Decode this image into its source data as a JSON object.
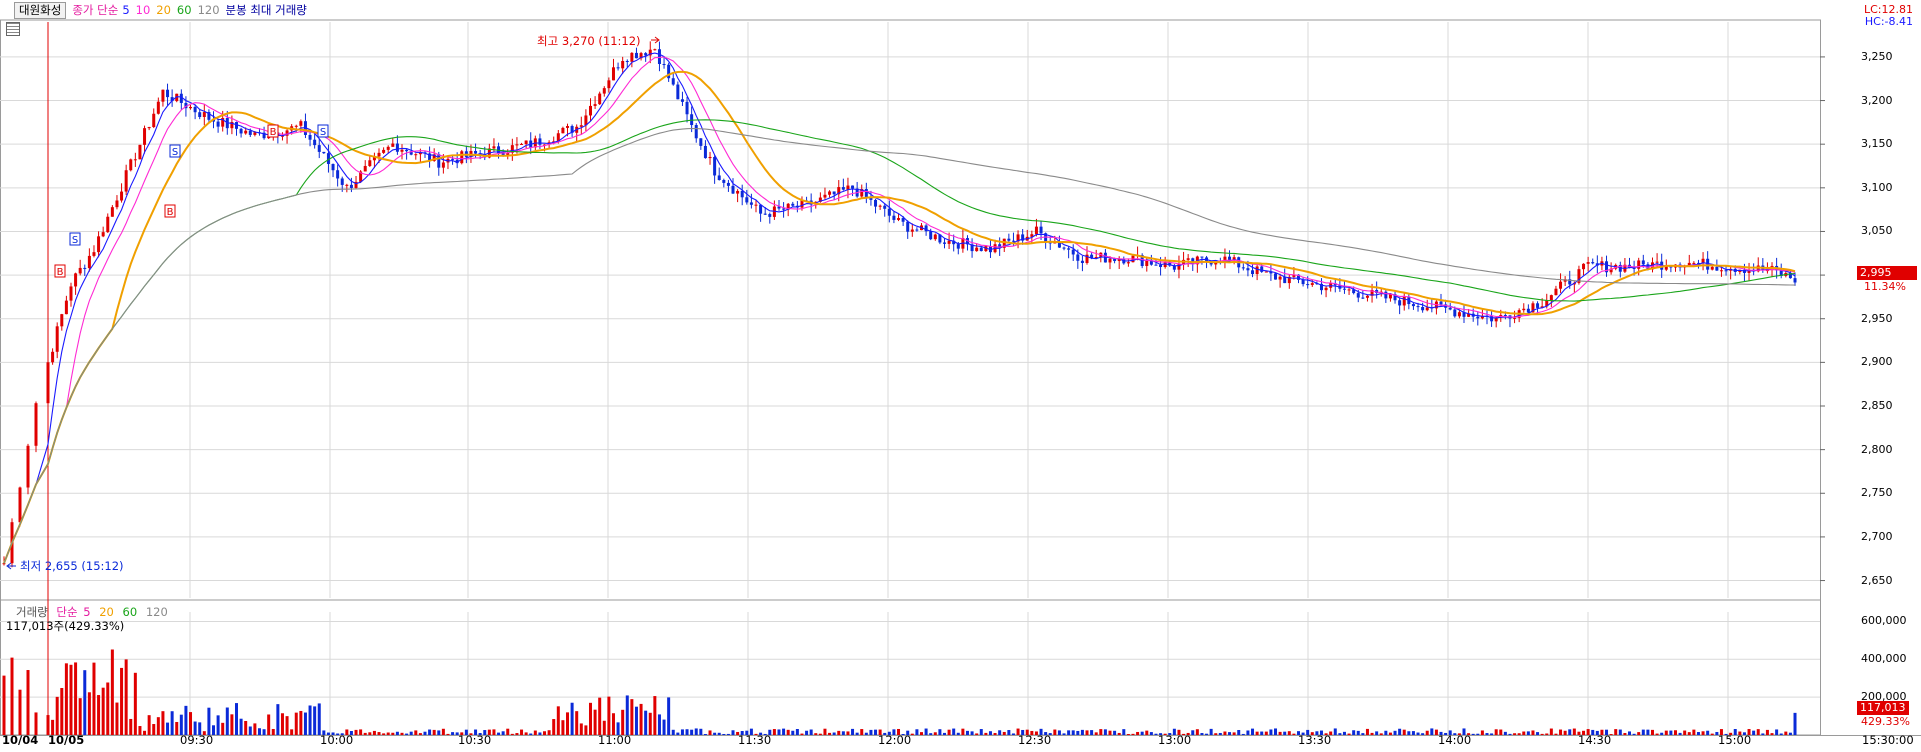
{
  "header": {
    "stock_name": "대원화성",
    "price_label": "종가 단순",
    "ma_periods": [
      "5",
      "10",
      "20",
      "60",
      "120"
    ],
    "volume_label": "분봉 최대 거래량"
  },
  "right_info": {
    "lc": "LC:12.81",
    "hc": "HC:-8.41"
  },
  "price_axis": [
    "3,250",
    "3,200",
    "3,150",
    "3,100",
    "3,050",
    "3,000",
    "2,950",
    "2,900",
    "2,850",
    "2,800",
    "2,750",
    "2,700",
    "2,650"
  ],
  "current": {
    "price": "2,995",
    "change_pct": "11.34%"
  },
  "high_label": "최고 3,270 (11:12)",
  "low_label": "최저 2,655 (15:12)",
  "volume_header": {
    "label": "거래량",
    "ma_label": "단순",
    "periods": [
      "5",
      "20",
      "60",
      "120"
    ]
  },
  "volume_value": "117,013주(429.33%)",
  "volume_axis": [
    "600,000",
    "400,000",
    "200,000"
  ],
  "volume_current": {
    "value": "117,013",
    "pct": "429.33%"
  },
  "time_axis": [
    "10/04",
    "10/05",
    "09:30",
    "10:00",
    "10:30",
    "11:00",
    "11:30",
    "12:00",
    "12:30",
    "13:00",
    "13:30",
    "14:00",
    "14:30",
    "15:00",
    "15:30:00"
  ],
  "colors": {
    "up": "#e00000",
    "down": "#0a2ad8",
    "ma5": "#1a1aff",
    "ma10": "#ff2ad4",
    "ma20": "#f0a000",
    "ma60": "#1aa51a",
    "ma120": "#8a8a8a",
    "grid": "#d9d9d9"
  },
  "chart_data": {
    "type": "candlestick",
    "interval": "1min",
    "price_range": [
      2630,
      3290
    ],
    "volume_range": [
      0,
      650000
    ],
    "close_anchors": [
      {
        "t": "10/04 15:00",
        "close": 2670
      },
      {
        "t": "10/05 09:00",
        "close": 2900
      },
      {
        "t": "09:05",
        "close": 2990
      },
      {
        "t": "09:10",
        "close": 3030
      },
      {
        "t": "09:20",
        "close": 3150
      },
      {
        "t": "09:25",
        "close": 3210
      },
      {
        "t": "09:35",
        "close": 3180
      },
      {
        "t": "09:45",
        "close": 3160
      },
      {
        "t": "09:55",
        "close": 3170
      },
      {
        "t": "10:05",
        "close": 3100
      },
      {
        "t": "10:15",
        "close": 3150
      },
      {
        "t": "10:25",
        "close": 3130
      },
      {
        "t": "10:35",
        "close": 3140
      },
      {
        "t": "10:45",
        "close": 3150
      },
      {
        "t": "10:55",
        "close": 3170
      },
      {
        "t": "11:05",
        "close": 3250
      },
      {
        "t": "11:12",
        "close": 3260
      },
      {
        "t": "11:20",
        "close": 3170
      },
      {
        "t": "11:25",
        "close": 3120
      },
      {
        "t": "11:35",
        "close": 3070
      },
      {
        "t": "11:45",
        "close": 3080
      },
      {
        "t": "11:55",
        "close": 3100
      },
      {
        "t": "12:05",
        "close": 3060
      },
      {
        "t": "12:15",
        "close": 3040
      },
      {
        "t": "12:25",
        "close": 3030
      },
      {
        "t": "12:35",
        "close": 3050
      },
      {
        "t": "12:45",
        "close": 3020
      },
      {
        "t": "12:55",
        "close": 3020
      },
      {
        "t": "13:05",
        "close": 3010
      },
      {
        "t": "13:15",
        "close": 3020
      },
      {
        "t": "13:25",
        "close": 3000
      },
      {
        "t": "13:35",
        "close": 2990
      },
      {
        "t": "13:45",
        "close": 2980
      },
      {
        "t": "13:55",
        "close": 2970
      },
      {
        "t": "14:05",
        "close": 2960
      },
      {
        "t": "14:15",
        "close": 2950
      },
      {
        "t": "14:25",
        "close": 2970
      },
      {
        "t": "14:35",
        "close": 3010
      },
      {
        "t": "14:45",
        "close": 3010
      },
      {
        "t": "14:55",
        "close": 3015
      },
      {
        "t": "15:05",
        "close": 3010
      },
      {
        "t": "15:15",
        "close": 3005
      },
      {
        "t": "15:20",
        "close": 2995
      }
    ],
    "moving_average_periods": [
      5,
      10,
      20,
      60,
      120
    ],
    "signals": [
      "B",
      "S",
      "B",
      "S",
      "B",
      "S"
    ]
  }
}
